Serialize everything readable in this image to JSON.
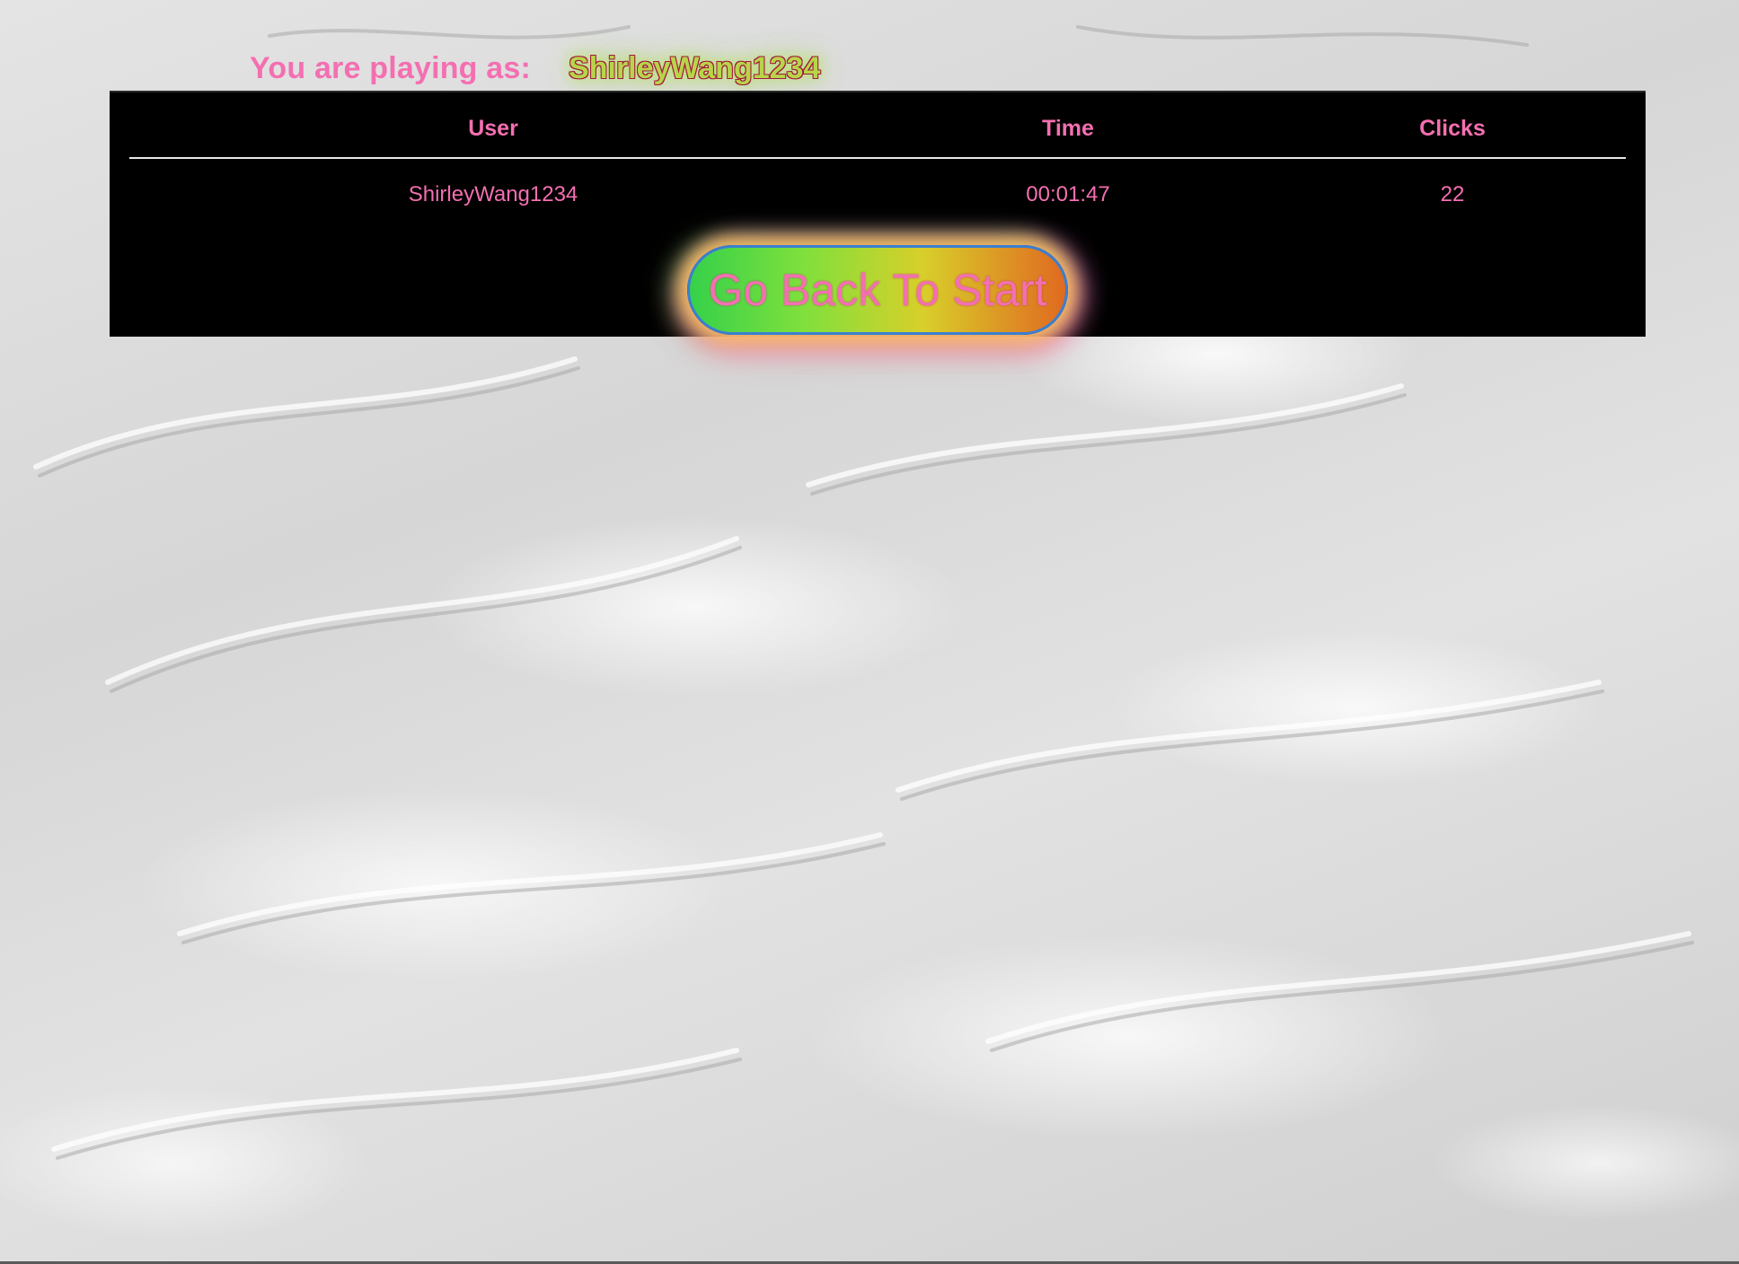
{
  "player": {
    "label": "You are playing as:",
    "username": "ShirleyWang1234"
  },
  "scoreboard": {
    "columns": [
      "User",
      "Time",
      "Clicks"
    ],
    "rows": [
      {
        "user": "ShirleyWang1234",
        "time": "00:01:47",
        "clicks": "22"
      }
    ]
  },
  "actions": {
    "back_label": "Go Back To Start"
  },
  "colors": {
    "text_accent": "#f46fb1",
    "username_fill": "#b8d44a",
    "board_background": "#000000",
    "button_border": "#3b7fd0"
  }
}
